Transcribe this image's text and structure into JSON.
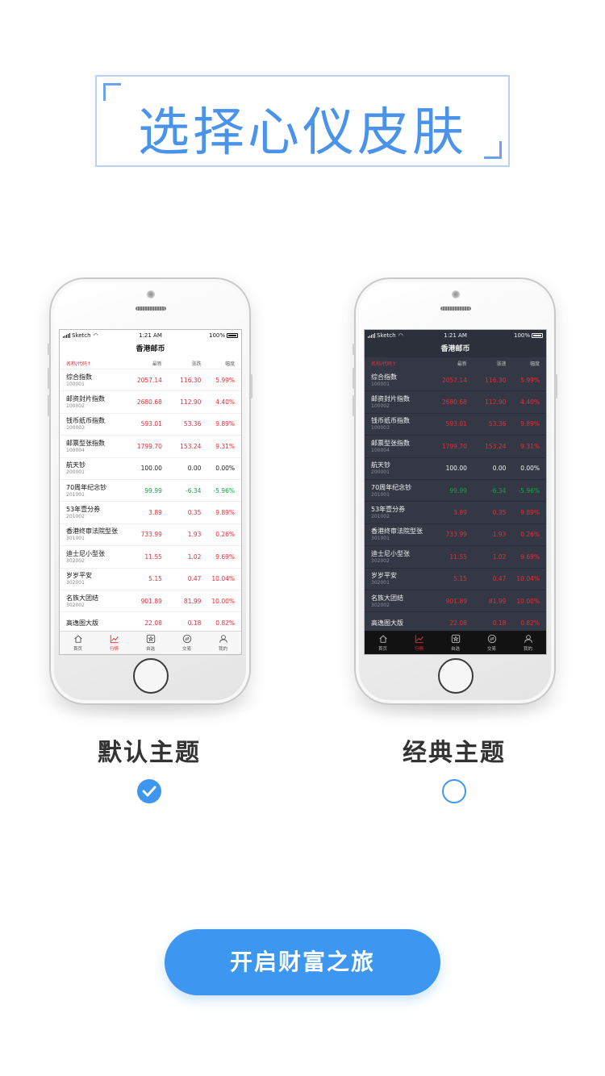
{
  "title": "选择心仪皮肤",
  "status": {
    "carrier": "Sketch",
    "time": "1:21 AM",
    "battery": "100%"
  },
  "screen_title": "香港邮币",
  "columns": {
    "name": "名称/代码",
    "sort_arrow": "↑",
    "last": "最新",
    "change": "涨跌",
    "change_dark": "涨速",
    "amplitude": "幅度"
  },
  "rows": [
    {
      "name": "综合指数",
      "code": "100001",
      "last": "2057.14",
      "change": "116.30",
      "pct": "5.99%",
      "dir": "red"
    },
    {
      "name": "邮资封片指数",
      "code": "100002",
      "last": "2680.68",
      "change": "112.90",
      "pct": "4.40%",
      "dir": "red"
    },
    {
      "name": "钱币纸币指数",
      "code": "100003",
      "last": "593.01",
      "change": "53.36",
      "pct": "9.89%",
      "dir": "red"
    },
    {
      "name": "邮票型张指数",
      "code": "100004",
      "last": "1799.70",
      "change": "153.24",
      "pct": "9.31%",
      "dir": "red"
    },
    {
      "name": "航天钞",
      "code": "200001",
      "last": "100.00",
      "change": "0.00",
      "pct": "0.00%",
      "dir": "flat"
    },
    {
      "name": "70周年纪念钞",
      "code": "201001",
      "last": "99.99",
      "change": "-6.34",
      "pct": "-5.96%",
      "dir": "green"
    },
    {
      "name": "53年壹分券",
      "code": "201002",
      "last": "3.89",
      "change": "0.35",
      "pct": "9.89%",
      "dir": "red"
    },
    {
      "name": "香港终审法院型张",
      "code": "301001",
      "last": "733.99",
      "change": "1.93",
      "pct": "0.26%",
      "dir": "red"
    },
    {
      "name": "迪士尼小型张",
      "code": "302002",
      "last": "11.55",
      "change": "1.02",
      "pct": "9.69%",
      "dir": "red"
    },
    {
      "name": "岁岁平安",
      "code": "302001",
      "last": "5.15",
      "change": "0.47",
      "pct": "10.04%",
      "dir": "red"
    },
    {
      "name": "名族大团结",
      "code": "302002",
      "last": "901.89",
      "change": "81.99",
      "pct": "10.00%",
      "dir": "red"
    },
    {
      "name": "高逸图大版",
      "code": "",
      "last": "22.08",
      "change": "0.18",
      "pct": "0.82%",
      "dir": "red"
    }
  ],
  "tabs": [
    {
      "label": "首页",
      "icon": "home-icon"
    },
    {
      "label": "行情",
      "icon": "chart-icon"
    },
    {
      "label": "自选",
      "icon": "star-icon"
    },
    {
      "label": "交易",
      "icon": "exchange-icon"
    },
    {
      "label": "我的",
      "icon": "user-icon"
    }
  ],
  "themes": [
    {
      "label": "默认主题",
      "selected": true
    },
    {
      "label": "经典主题",
      "selected": false
    }
  ],
  "cta_label": "开启财富之旅",
  "colors": {
    "accent": "#3d96ef",
    "up": "#e0303a",
    "down": "#18a34a",
    "dark_bg": "#343845"
  }
}
